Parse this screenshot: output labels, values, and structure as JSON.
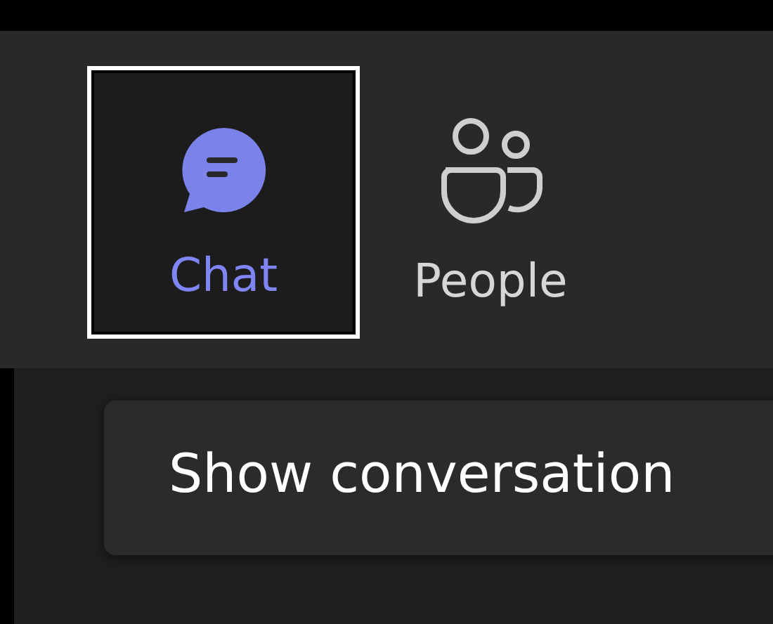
{
  "toolbar": {
    "items": [
      {
        "kind": "chat",
        "label": "Chat",
        "selected": true
      },
      {
        "kind": "people",
        "label": "People",
        "selected": false
      }
    ]
  },
  "tooltip": {
    "text": "Show conversation"
  }
}
